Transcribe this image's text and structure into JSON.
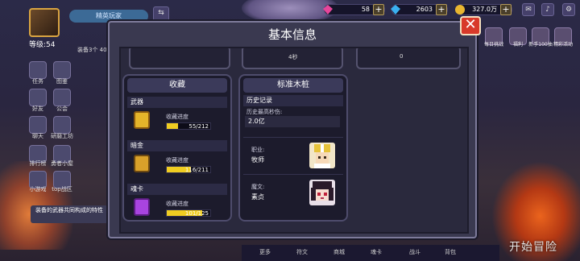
{
  "hud": {
    "level": "等级:54",
    "name_pill": "精英玩家",
    "resources": [
      {
        "icon": "pink-gem-icon",
        "value": "58",
        "plus": "+"
      },
      {
        "icon": "blue-diamond-icon",
        "value": "2603",
        "plus": "+"
      },
      {
        "icon": "gold-coin-icon",
        "value": "327.0万",
        "plus": "+"
      }
    ],
    "sub_status": "装备3个 40",
    "right_buttons": [
      "每日挑战",
      "福利",
      "新手100抽",
      "精彩活动"
    ]
  },
  "side_menu": [
    "任务",
    "图鉴",
    "好友",
    "公会",
    "聊天",
    "研磨工坊",
    "排行榜",
    "勇者小屋",
    "小游戏",
    "top战区"
  ],
  "tip": "装备的武器共同构成的特性",
  "bottom_tabs": [
    "更多",
    "符文",
    "商城",
    "魂卡",
    "战斗",
    "背包"
  ],
  "start_button": "开始冒险",
  "dialog": {
    "title": "基本信息",
    "close": "✕",
    "top_cards": [
      {
        "value": "4秒"
      },
      {
        "value": "0"
      }
    ],
    "collection": {
      "title": "收藏",
      "categories": [
        {
          "label": "武器",
          "progress_label": "收藏进度",
          "progress_text": "55/212",
          "fraction": 0.259,
          "icon": "weapon-chest-icon"
        },
        {
          "label": "暗金",
          "progress_label": "收藏进度",
          "progress_text": "116/211",
          "fraction": 0.55,
          "icon": "dark-gold-book-icon"
        },
        {
          "label": "魂卡",
          "progress_label": "收藏进度",
          "progress_text": "101/125",
          "fraction": 0.808,
          "icon": "soul-card-icon"
        }
      ]
    },
    "dummy": {
      "title": "标准木桩",
      "history_label": "历史记录",
      "best_dps_label": "历史最高秒伤:",
      "best_dps_value": "2.0亿",
      "rows": [
        {
          "key": "职业:",
          "value": "牧师",
          "portrait": "priest-portrait-icon"
        },
        {
          "key": "魔文:",
          "value": "素贞",
          "portrait": "demon-rune-portrait-icon"
        }
      ]
    }
  },
  "colors": {
    "progress": "#f0cd21",
    "close": "#d83a2a",
    "panel_border": "#4e4c6c"
  }
}
